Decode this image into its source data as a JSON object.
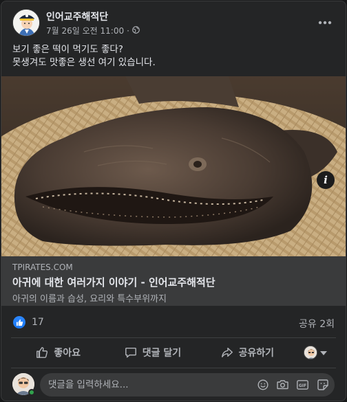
{
  "post": {
    "page_name": "인어교주해적단",
    "timestamp": "7월 26일 오전 11:00",
    "separator": "·",
    "privacy_icon": "globe-icon",
    "text_lines": [
      "보기 좋은 떡이 먹기도 좋다?",
      "못생겨도 맛좋은 생선 여기 있습니다."
    ]
  },
  "link_preview": {
    "domain": "TPIRATES.COM",
    "title": "아귀에 대한 여러가지 이야기 - 인어교주해적단",
    "description": "아귀의 이름과 습성, 요리와 특수부위까지",
    "info_label": "i"
  },
  "reactions": {
    "like_count": "17",
    "share_count": "공유 2회"
  },
  "actions": {
    "like_label": "좋아요",
    "comment_label": "댓글 달기",
    "share_label": "공유하기"
  },
  "composer": {
    "placeholder": "댓글을 입력하세요..."
  },
  "colors": {
    "background": "#242526",
    "accent": "#1877f2",
    "secondary_text": "#b0b3b8"
  }
}
